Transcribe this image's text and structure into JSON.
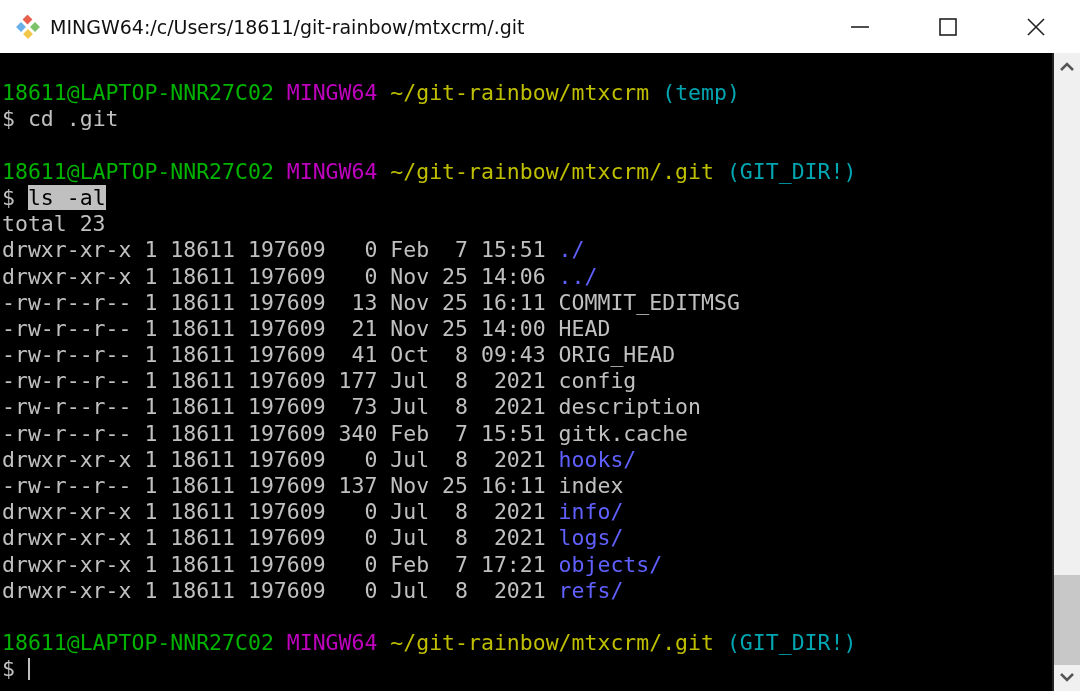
{
  "window": {
    "title": "MINGW64:/c/Users/18611/git-rainbow/mtxcrm/.git"
  },
  "lines": [
    {
      "kind": "blank"
    },
    {
      "kind": "prompt",
      "user": "18611@LAPTOP-NNR27C02",
      "shell": "MINGW64",
      "path": "~/git-rainbow/mtxcrm",
      "branch": "(temp)"
    },
    {
      "kind": "command",
      "prompt": "$",
      "command": "cd .git",
      "highlighted": false
    },
    {
      "kind": "blank"
    },
    {
      "kind": "prompt",
      "user": "18611@LAPTOP-NNR27C02",
      "shell": "MINGW64",
      "path": "~/git-rainbow/mtxcrm/.git",
      "branch": "(GIT_DIR!)"
    },
    {
      "kind": "command",
      "prompt": "$",
      "command": "ls -al",
      "highlighted": true
    },
    {
      "kind": "output",
      "text": "total 23"
    },
    {
      "kind": "entry",
      "meta": "drwxr-xr-x 1 18611 197609   0 Feb  7 15:51",
      "name": "./",
      "is_dir": true
    },
    {
      "kind": "entry",
      "meta": "drwxr-xr-x 1 18611 197609   0 Nov 25 14:06",
      "name": "../",
      "is_dir": true
    },
    {
      "kind": "entry",
      "meta": "-rw-r--r-- 1 18611 197609  13 Nov 25 16:11",
      "name": "COMMIT_EDITMSG",
      "is_dir": false
    },
    {
      "kind": "entry",
      "meta": "-rw-r--r-- 1 18611 197609  21 Nov 25 14:00",
      "name": "HEAD",
      "is_dir": false
    },
    {
      "kind": "entry",
      "meta": "-rw-r--r-- 1 18611 197609  41 Oct  8 09:43",
      "name": "ORIG_HEAD",
      "is_dir": false
    },
    {
      "kind": "entry",
      "meta": "-rw-r--r-- 1 18611 197609 177 Jul  8  2021",
      "name": "config",
      "is_dir": false
    },
    {
      "kind": "entry",
      "meta": "-rw-r--r-- 1 18611 197609  73 Jul  8  2021",
      "name": "description",
      "is_dir": false
    },
    {
      "kind": "entry",
      "meta": "-rw-r--r-- 1 18611 197609 340 Feb  7 15:51",
      "name": "gitk.cache",
      "is_dir": false
    },
    {
      "kind": "entry",
      "meta": "drwxr-xr-x 1 18611 197609   0 Jul  8  2021",
      "name": "hooks/",
      "is_dir": true
    },
    {
      "kind": "entry",
      "meta": "-rw-r--r-- 1 18611 197609 137 Nov 25 16:11",
      "name": "index",
      "is_dir": false
    },
    {
      "kind": "entry",
      "meta": "drwxr-xr-x 1 18611 197609   0 Jul  8  2021",
      "name": "info/",
      "is_dir": true
    },
    {
      "kind": "entry",
      "meta": "drwxr-xr-x 1 18611 197609   0 Jul  8  2021",
      "name": "logs/",
      "is_dir": true
    },
    {
      "kind": "entry",
      "meta": "drwxr-xr-x 1 18611 197609   0 Feb  7 17:21",
      "name": "objects/",
      "is_dir": true
    },
    {
      "kind": "entry",
      "meta": "drwxr-xr-x 1 18611 197609   0 Jul  8  2021",
      "name": "refs/",
      "is_dir": true
    },
    {
      "kind": "blank"
    },
    {
      "kind": "prompt",
      "user": "18611@LAPTOP-NNR27C02",
      "shell": "MINGW64",
      "path": "~/git-rainbow/mtxcrm/.git",
      "branch": "(GIT_DIR!)"
    },
    {
      "kind": "input",
      "prompt": "$"
    }
  ]
}
